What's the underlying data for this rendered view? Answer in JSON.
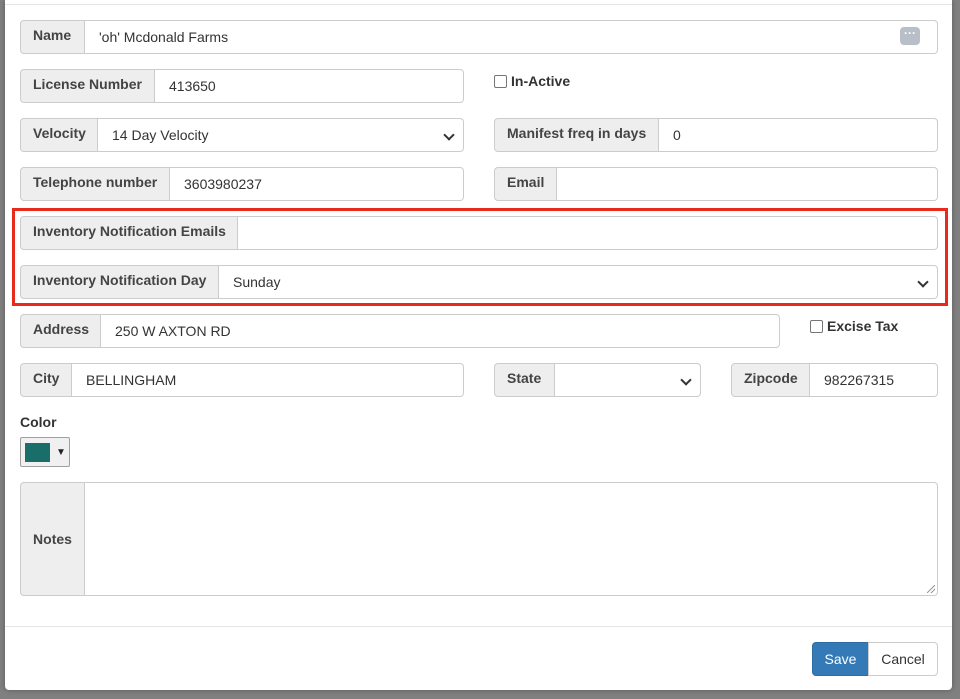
{
  "form": {
    "name": {
      "label": "Name",
      "value": "'oh' Mcdonald Farms",
      "more_icon": "more-dots-icon",
      "more_glyph": "···"
    },
    "license": {
      "label": "License Number",
      "value": "413650"
    },
    "inactive": {
      "label": "In-Active",
      "checked": false
    },
    "velocity": {
      "label": "Velocity",
      "value": "14 Day Velocity"
    },
    "manifest_freq": {
      "label": "Manifest freq in days",
      "value": "0"
    },
    "telephone": {
      "label": "Telephone number",
      "value": "3603980237"
    },
    "email": {
      "label": "Email",
      "value": ""
    },
    "inventory_emails": {
      "label": "Inventory Notification Emails",
      "value": ""
    },
    "inventory_day": {
      "label": "Inventory Notification Day",
      "value": "Sunday"
    },
    "address": {
      "label": "Address",
      "value": "250 W AXTON RD"
    },
    "excise_tax": {
      "label": "Excise Tax",
      "checked": false
    },
    "city": {
      "label": "City",
      "value": "BELLINGHAM"
    },
    "state": {
      "label": "State",
      "value": ""
    },
    "zipcode": {
      "label": "Zipcode",
      "value": "982267315"
    },
    "color": {
      "label": "Color",
      "value": "#1a6e6a",
      "arrow": "▼"
    },
    "notes": {
      "label": "Notes",
      "value": ""
    }
  },
  "footer": {
    "save_label": "Save",
    "cancel_label": "Cancel"
  },
  "colors": {
    "highlight": "#e8291c",
    "primary": "#337ab7"
  }
}
